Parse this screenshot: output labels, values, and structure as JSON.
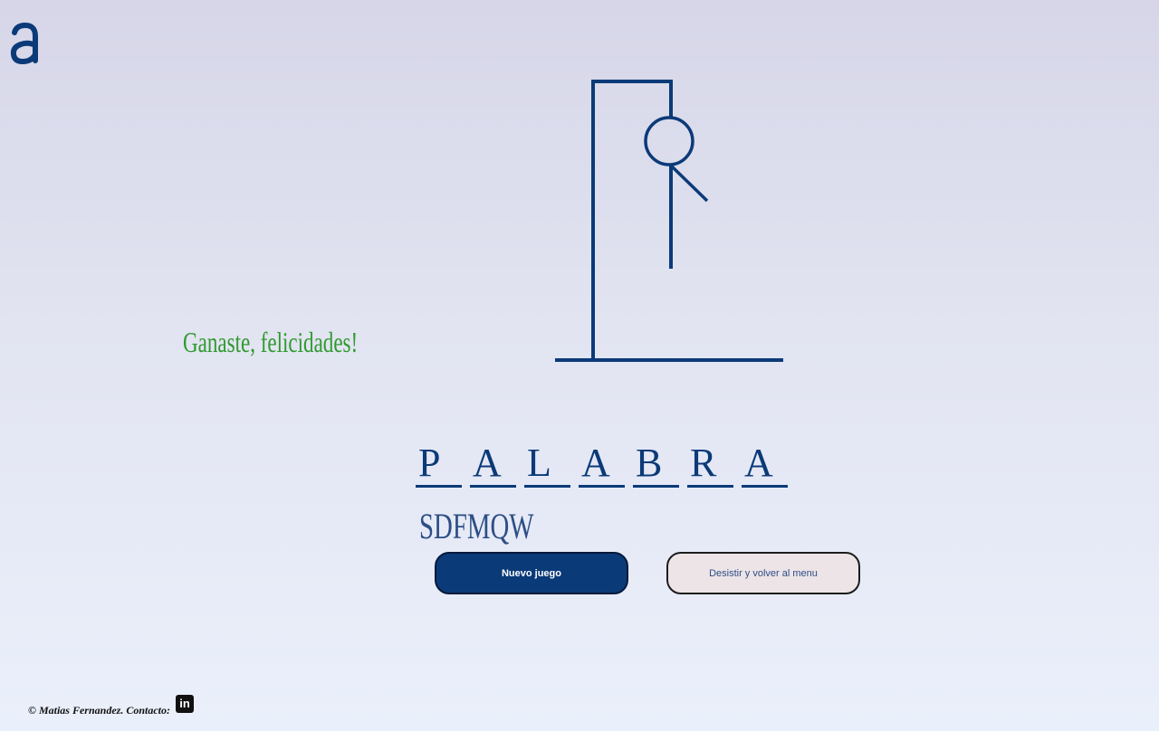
{
  "logo": {
    "icon": "alura-a-logo"
  },
  "game": {
    "message": "Ganaste, felicidades!",
    "word": [
      "P",
      "A",
      "L",
      "A",
      "B",
      "R",
      "A"
    ],
    "wrong_letters": "SDFMQW",
    "errors_drawn": 6
  },
  "buttons": {
    "new_game": "Nuevo juego",
    "give_up": "Desistir y volver al menu"
  },
  "footer": {
    "text": "© Matias Fernandez. Contacto:",
    "icon": "linkedin-icon",
    "icon_text": "in"
  },
  "colors": {
    "primary": "#0b3a78",
    "win": "#2f9a2f",
    "wrong": "#2d4e85",
    "secondary_button": "#ece4e7"
  }
}
